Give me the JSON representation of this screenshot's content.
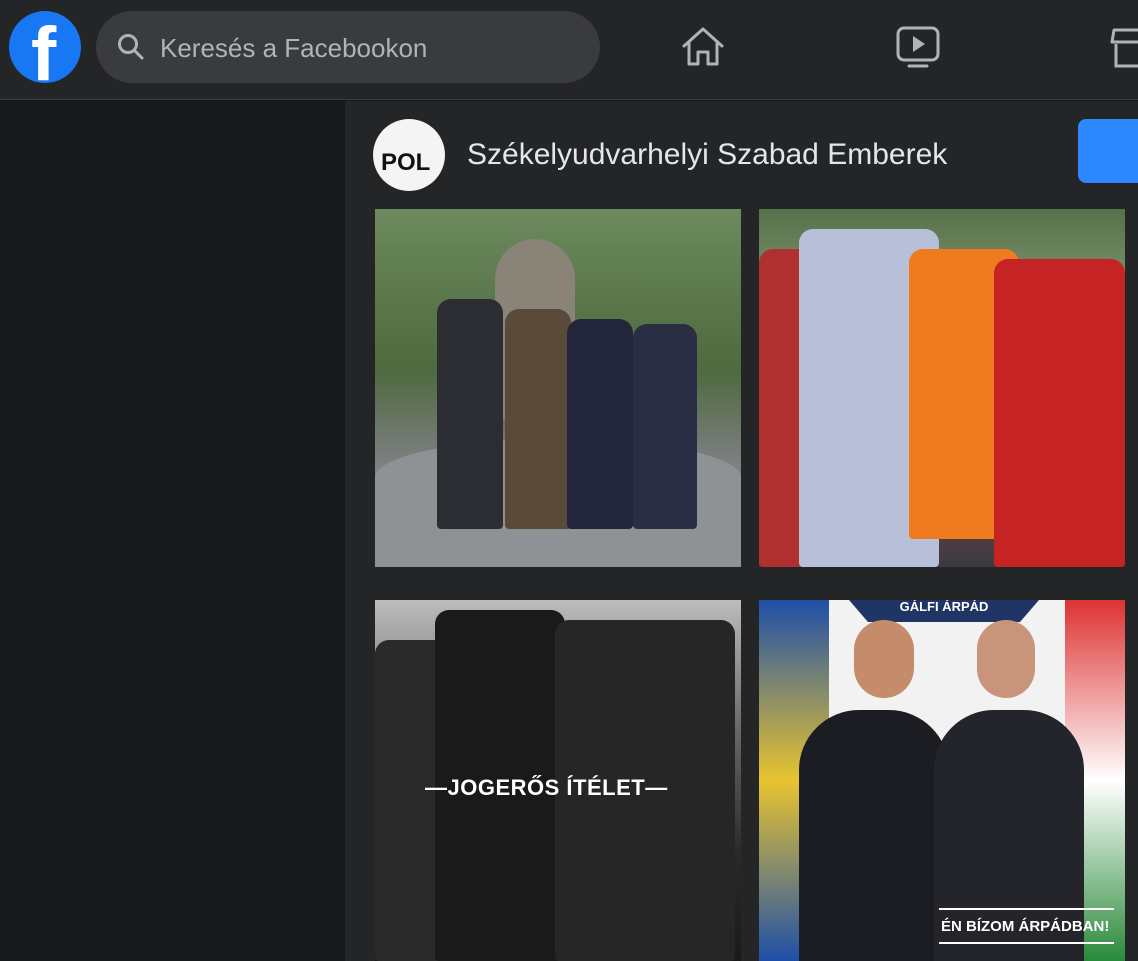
{
  "topbar": {
    "logo_letter": "f",
    "search_placeholder": "Keresés a Facebookon"
  },
  "page_header": {
    "avatar_text": "POL",
    "name": "Székelyudvarhelyi Szabad Emberek"
  },
  "photos": [
    {
      "name": "photo-four-men-statue"
    },
    {
      "name": "photo-handshake-crowd"
    },
    {
      "name": "photo-police-verdict",
      "caption": "—JOGERŐS ÍTÉLET—"
    },
    {
      "name": "photo-campaign-poster",
      "banner": "GÁLFI ÁRPÁD",
      "quote": "ÉN BÍZOM ÁRPÁDBAN!"
    }
  ],
  "colors": {
    "brand": "#1877f2",
    "topbar_bg": "#242526",
    "page_bg": "#18191a",
    "search_bg": "#3a3b3c",
    "action_button": "#2d88ff"
  }
}
